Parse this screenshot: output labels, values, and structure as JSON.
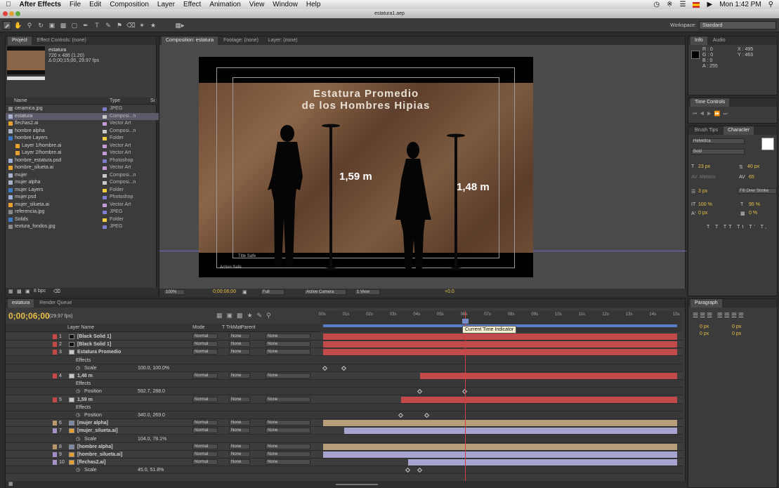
{
  "menubar": {
    "app": "After Effects",
    "items": [
      "File",
      "Edit",
      "Composition",
      "Layer",
      "Effect",
      "Animation",
      "View",
      "Window",
      "Help"
    ],
    "clock": "Mon 1:42 PM"
  },
  "window": {
    "title": "estatura1.aep"
  },
  "workspace": {
    "label": "Workspace:",
    "value": "Standard"
  },
  "project": {
    "tabs": [
      "Project",
      "Effect Controls: (none)"
    ],
    "selected_name": "estatura",
    "selected_info1": "720 x 486 (1.20)",
    "selected_info2": "Δ 0;00;15;00, 29.97 fps",
    "col_name": "Name",
    "col_type": "Type",
    "col_size": "Si",
    "items": [
      {
        "name": "ceramica.jpg",
        "type": "JPEG",
        "indent": 0,
        "icon": "#8a8a8a",
        "label": "#7d7dcc"
      },
      {
        "name": "estatura",
        "type": "Composi...n",
        "indent": 0,
        "icon": "#aab3c9",
        "label": "#c8c8c8"
      },
      {
        "name": "flechas2.ai",
        "type": "Vector Art",
        "indent": 0,
        "icon": "#e8a030",
        "label": "#c49bd6"
      },
      {
        "name": "hombre alpha",
        "type": "Composi...n",
        "indent": 0,
        "icon": "#aab3c9",
        "label": "#c8c8c8"
      },
      {
        "name": "hombre Layers",
        "type": "Folder",
        "indent": 0,
        "icon": "#3d7ac8",
        "label": "#f0d040",
        "folder": true
      },
      {
        "name": "Layer 1/hombre.ai",
        "type": "Vector Art",
        "indent": 1,
        "icon": "#e8a030",
        "label": "#c49bd6"
      },
      {
        "name": "Layer 2/hombre.ai",
        "type": "Vector Art",
        "indent": 1,
        "icon": "#e8a030",
        "label": "#c49bd6"
      },
      {
        "name": "hombre_estatura.psd",
        "type": "Photoshop",
        "indent": 0,
        "icon": "#9db0d8",
        "label": "#7d7dcc"
      },
      {
        "name": "hombre_silueta.ai",
        "type": "Vector Art",
        "indent": 0,
        "icon": "#e8a030",
        "label": "#c49bd6"
      },
      {
        "name": "mujer",
        "type": "Composi...n",
        "indent": 0,
        "icon": "#aab3c9",
        "label": "#c8c8c8"
      },
      {
        "name": "mujer alpha",
        "type": "Composi...n",
        "indent": 0,
        "icon": "#aab3c9",
        "label": "#c8c8c8"
      },
      {
        "name": "mujer Layers",
        "type": "Folder",
        "indent": 0,
        "icon": "#3d7ac8",
        "label": "#f0d040",
        "folder": true
      },
      {
        "name": "mujer.psd",
        "type": "Photoshop",
        "indent": 0,
        "icon": "#9db0d8",
        "label": "#7d7dcc"
      },
      {
        "name": "mujer_silueta.ai",
        "type": "Vector Art",
        "indent": 0,
        "icon": "#e8a030",
        "label": "#c49bd6"
      },
      {
        "name": "referencia.jpg",
        "type": "JPEG",
        "indent": 0,
        "icon": "#8a8a8a",
        "label": "#7d7dcc"
      },
      {
        "name": "Solids",
        "type": "Folder",
        "indent": 0,
        "icon": "#3d7ac8",
        "label": "#f0d040",
        "folder": true
      },
      {
        "name": "textura_fondos.jpg",
        "type": "JPEG",
        "indent": 0,
        "icon": "#8a8a8a",
        "label": "#7d7dcc"
      }
    ],
    "bpc": "8 bpc"
  },
  "comp": {
    "tabs": [
      "Composition: estatura",
      "Footage: (none)",
      "Layer: (none)"
    ],
    "title_line1": "Estatura Promedio",
    "title_line2": "de los Hombres Hipias",
    "label_man": "1,59 m",
    "label_woman": "1,48 m",
    "title_safe": "Title Safe",
    "action_safe": "Action Safe",
    "zoom": "100%",
    "timecode": "0;00;06;00",
    "resolution": "Full",
    "camera": "Active Camera",
    "view": "1 View",
    "offset": "+0.0"
  },
  "info": {
    "tabs": [
      "Info",
      "Audio"
    ],
    "r": "R : 0",
    "g": "G : 0",
    "b": "B : 0",
    "a": "A : 255",
    "x": "X : 495",
    "y": "Y : 463"
  },
  "timecontrols": {
    "tab": "Time Controls"
  },
  "character": {
    "tabs": [
      "Brush Tips",
      "Character"
    ],
    "font": "Helvetica",
    "style": "Bold",
    "size": "23 px",
    "leading": "40 px",
    "kerning": "Metrics",
    "tracking": "65",
    "stroke": "3 px",
    "stroke_mode": "Fill Over Stroke",
    "vscale": "100 %",
    "hscale": "95 %",
    "baseline": "0 px",
    "tsume": "0 %"
  },
  "paragraph": {
    "tab": "Paragraph",
    "v1": "0 px",
    "v2": "0 px",
    "v3": "0 px",
    "v4": "0 px",
    "v5": "0 px"
  },
  "timeline": {
    "tabs": [
      "estatura",
      "Render Queue"
    ],
    "timecode": "0;00;06;00",
    "fps": "(29.97 fps)",
    "col_layer": "Layer Name",
    "col_mode": "Mode",
    "col_trkmat": "T  TrkMat",
    "col_parent": "Parent",
    "ruler": [
      "00s",
      "01s",
      "02s",
      "03s",
      "04s",
      "05s",
      "06s",
      "07s",
      "08s",
      "09s",
      "10s",
      "11s",
      "12s",
      "13s",
      "14s",
      "15s"
    ],
    "tooltip": "Current Time Indicator",
    "current_time_s": 6,
    "rows": [
      {
        "kind": "layer",
        "num": "1",
        "name": "[Black Solid 1]",
        "mode": "Normal",
        "trk": "None",
        "parent": "None",
        "label": "#c84848",
        "bar_color": "#c24a4a",
        "bar_start": 0,
        "bar_end": 15,
        "swatch": "#111"
      },
      {
        "kind": "layer",
        "num": "2",
        "name": "[Black Solid 1]",
        "mode": "Normal",
        "trk": "None",
        "parent": "None",
        "label": "#c84848",
        "bar_color": "#c24a4a",
        "bar_start": 0,
        "bar_end": 15,
        "swatch": "#111"
      },
      {
        "kind": "layer",
        "num": "3",
        "name": "Estatura Promedio",
        "mode": "Normal",
        "trk": "None",
        "parent": "None",
        "label": "#c84848",
        "bar_color": "#c24a4a",
        "bar_start": 0,
        "bar_end": 15,
        "text": true
      },
      {
        "kind": "effects",
        "name": "Effects"
      },
      {
        "kind": "prop",
        "name": "Scale",
        "value": "100.0, 100.0%",
        "keys": [
          0.1,
          0.9
        ]
      },
      {
        "kind": "layer",
        "num": "4",
        "name": "1,48 m",
        "mode": "Normal",
        "trk": "None",
        "parent": "None",
        "label": "#c84848",
        "bar_color": "#c24a4a",
        "bar_start": 4.1,
        "bar_end": 15,
        "text": true
      },
      {
        "kind": "effects",
        "name": "Effects"
      },
      {
        "kind": "prop",
        "name": "Position",
        "value": "592.7, 288.0",
        "keys": [
          4.1,
          6.0
        ]
      },
      {
        "kind": "layer",
        "num": "5",
        "name": "1,59 m",
        "mode": "Normal",
        "trk": "None",
        "parent": "None",
        "label": "#c84848",
        "bar_color": "#c24a4a",
        "bar_start": 3.3,
        "bar_end": 15,
        "text": true
      },
      {
        "kind": "effects",
        "name": "Effects"
      },
      {
        "kind": "prop",
        "name": "Position",
        "value": "340.0, 269.0",
        "keys": [
          3.3,
          4.4
        ]
      },
      {
        "kind": "layer",
        "num": "6",
        "name": "[mujer alpha]",
        "mode": "Normal",
        "trk": "None",
        "parent": "None",
        "label": "#b89a6a",
        "bar_color": "#b79f7c",
        "bar_start": 0,
        "bar_end": 15,
        "swatch": "#7a8aa8"
      },
      {
        "kind": "layer",
        "num": "7",
        "name": "[mujer_silueta.ai]",
        "mode": "Normal",
        "trk": "None",
        "parent": "None",
        "label": "#a78fc7",
        "bar_color": "#a7a5cf",
        "bar_start": 0.9,
        "bar_end": 15,
        "swatch": "#e8a030"
      },
      {
        "kind": "prop2",
        "name": "Scale",
        "value": "104.0, 78.1%"
      },
      {
        "kind": "layer",
        "num": "8",
        "name": "[hombre alpha]",
        "mode": "Normal",
        "trk": "None",
        "parent": "None",
        "label": "#b89a6a",
        "bar_color": "#b79f7c",
        "bar_start": 0,
        "bar_end": 15,
        "swatch": "#7a8aa8"
      },
      {
        "kind": "layer",
        "num": "9",
        "name": "[hombre_silueta.ai]",
        "mode": "Normal",
        "trk": "None",
        "parent": "None",
        "label": "#a78fc7",
        "bar_color": "#a7a5cf",
        "bar_start": 0,
        "bar_end": 15,
        "swatch": "#e8a030"
      },
      {
        "kind": "layer",
        "num": "10",
        "name": "[flechas2.ai]",
        "mode": "Normal",
        "trk": "None",
        "parent": "None",
        "label": "#a78fc7",
        "bar_color": "#a7a5cf",
        "bar_start": 3.6,
        "bar_end": 15,
        "swatch": "#e8a030"
      },
      {
        "kind": "prop",
        "name": "Scale",
        "value": "45.0, 51.8%",
        "keys": [
          3.6,
          4.1
        ]
      }
    ]
  },
  "colors": {
    "accent_yellow": "#e8c048",
    "playhead": "#d04040",
    "work_area": "#5a7cc8"
  }
}
